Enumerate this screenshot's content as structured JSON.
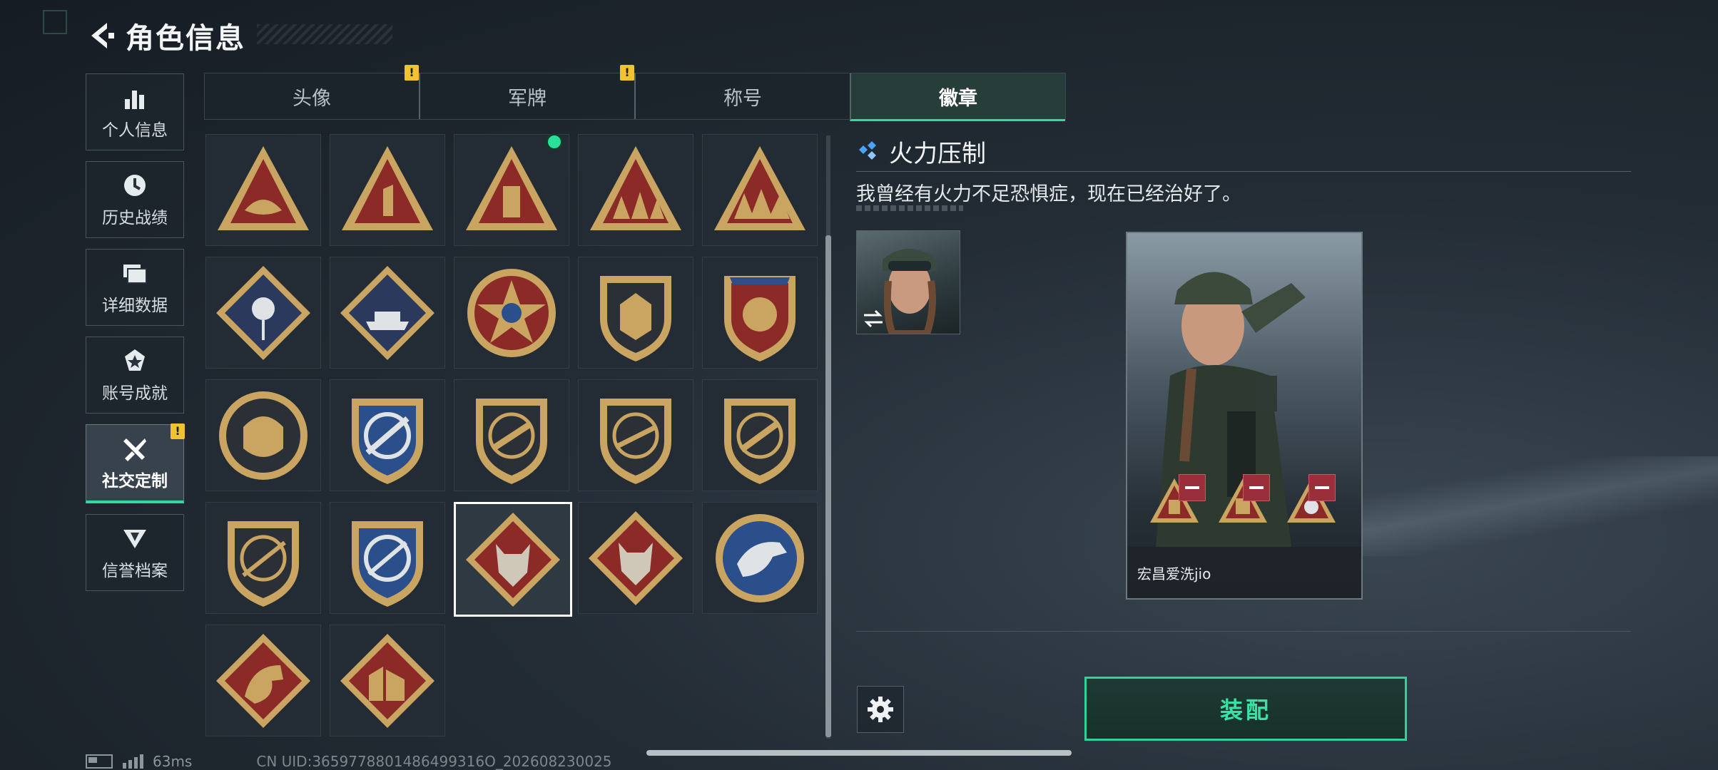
{
  "header": {
    "title": "角色信息"
  },
  "sidebar": {
    "items": [
      {
        "label": "个人信息",
        "icon": "bar-chart-icon"
      },
      {
        "label": "历史战绩",
        "icon": "history-icon"
      },
      {
        "label": "详细数据",
        "icon": "folder-icon"
      },
      {
        "label": "账号成就",
        "icon": "achievement-icon"
      },
      {
        "label": "社交定制",
        "icon": "tools-icon",
        "active": true,
        "badge": "!"
      },
      {
        "label": "信誉档案",
        "icon": "credit-icon"
      }
    ]
  },
  "tabs": [
    {
      "label": "头像",
      "badge": "!"
    },
    {
      "label": "军牌",
      "badge": "!"
    },
    {
      "label": "称号"
    },
    {
      "label": "徽章",
      "active": true
    }
  ],
  "badges": {
    "selected_index": 17,
    "new_index": 2,
    "items": [
      {
        "name": "triangle-wings-badge-icon"
      },
      {
        "name": "triangle-number-one-badge-icon"
      },
      {
        "name": "triangle-usb-badge-icon"
      },
      {
        "name": "triangle-squad-badge-icon"
      },
      {
        "name": "triangle-team-badge-icon"
      },
      {
        "name": "diamond-rose-badge-icon"
      },
      {
        "name": "diamond-tank-badge-icon"
      },
      {
        "name": "star-emblem-badge-icon"
      },
      {
        "name": "shield-winged-badge-icon"
      },
      {
        "name": "shield-ornate-badge-icon"
      },
      {
        "name": "round-skull-badge-icon"
      },
      {
        "name": "blue-crosshair-badge-icon"
      },
      {
        "name": "shield-rifle-badge-icon"
      },
      {
        "name": "shield-shotgun-badge-icon"
      },
      {
        "name": "shield-smg-badge-icon"
      },
      {
        "name": "shield-sniper-badge-icon"
      },
      {
        "name": "blue-crosshair-knife-badge-icon"
      },
      {
        "name": "wolf-diamond-badge-icon"
      },
      {
        "name": "wolf-diamond-red-badge-icon"
      },
      {
        "name": "eagle-round-badge-icon"
      },
      {
        "name": "dragon-diamond-badge-icon"
      },
      {
        "name": "building-diamond-badge-icon"
      }
    ]
  },
  "detail": {
    "badge_name": "火力压制",
    "description": "我曾经有火力不足恐惧症，现在已经治好了。",
    "player_name": "宏昌爱洗jio",
    "equip_label": "装配"
  },
  "status": {
    "ping": "63ms",
    "uid": "CN UID:3659778801486499316O_202608230025"
  },
  "colors": {
    "accent": "#31d9a0",
    "warn": "#f2c231",
    "badge_gold": "#c9a561",
    "badge_red": "#8b2a26",
    "badge_blue": "#2b4f8a"
  }
}
